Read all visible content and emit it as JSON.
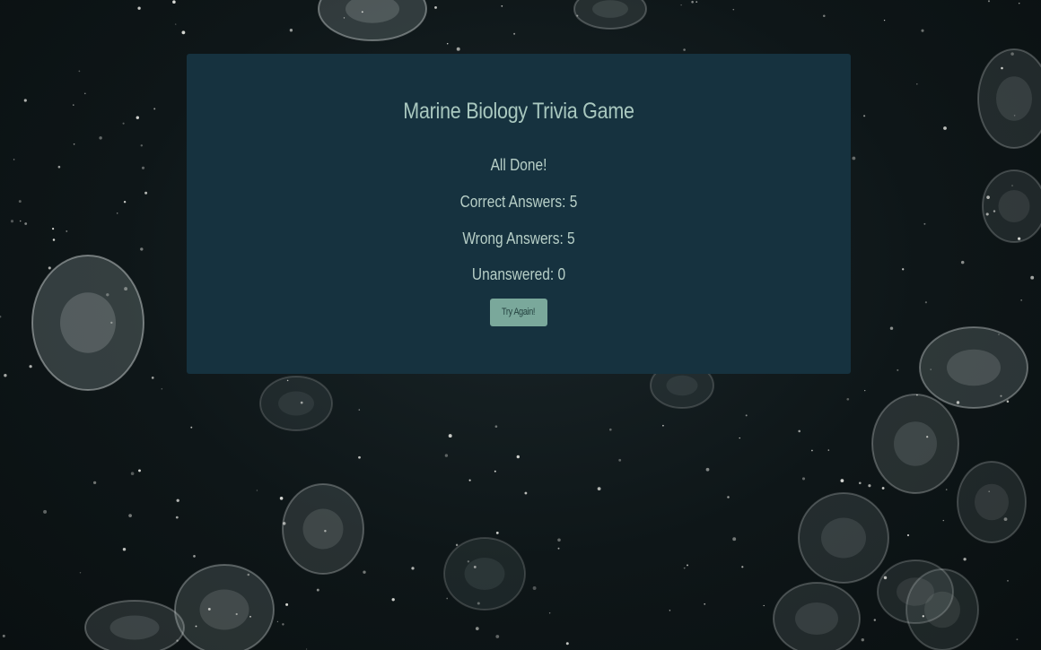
{
  "game": {
    "title": "Marine Biology Trivia Game",
    "status": "All Done!",
    "correct_text": "Correct Answers: 5",
    "wrong_text": "Wrong Answers: 5",
    "unanswered_text": "Unanswered: 0",
    "retry_label": "Try Again!"
  },
  "colors": {
    "panel": "#16323f",
    "text": "#b7cfc7",
    "button": "#7aa89b",
    "button_text": "#23413f",
    "background": "#0d1516"
  },
  "icons": {
    "background": "jellyfish-background-image"
  }
}
